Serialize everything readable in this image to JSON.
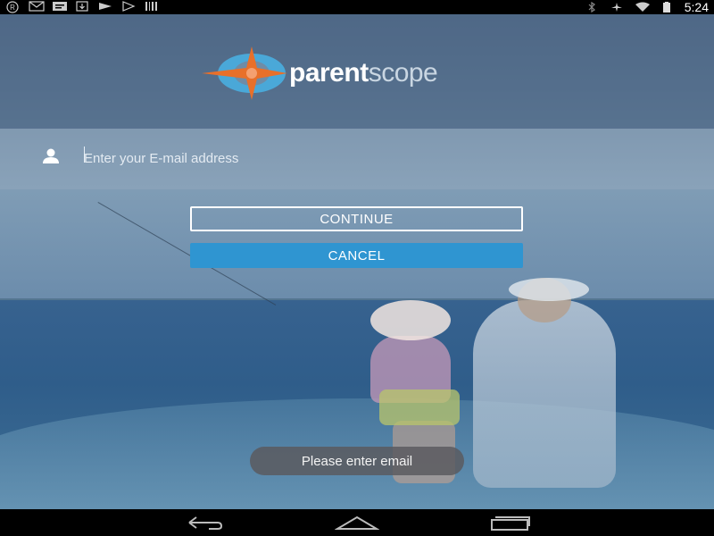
{
  "status_bar": {
    "left_icons": [
      "registered-icon",
      "gmail-icon",
      "message-icon",
      "download-icon",
      "cast-icon",
      "play-store-icon",
      "barcode-icon"
    ],
    "right_icons": [
      "bluetooth-icon",
      "airplane-icon",
      "wifi-icon",
      "battery-icon"
    ],
    "time": "5:24"
  },
  "logo": {
    "brand_bold": "parent",
    "brand_light": "scope",
    "mark_icon": "compass-star-icon",
    "colors": {
      "orange": "#e8702a",
      "blue": "#4aa8d8"
    }
  },
  "email": {
    "icon": "user-icon",
    "placeholder": "Enter your E-mail address",
    "value": ""
  },
  "buttons": {
    "continue_label": "CONTINUE",
    "cancel_label": "CANCEL",
    "cancel_color": "#2f95d1"
  },
  "toast": {
    "message": "Please enter email"
  },
  "nav_bar": {
    "buttons": [
      "back-icon",
      "home-icon",
      "recent-apps-icon"
    ]
  }
}
